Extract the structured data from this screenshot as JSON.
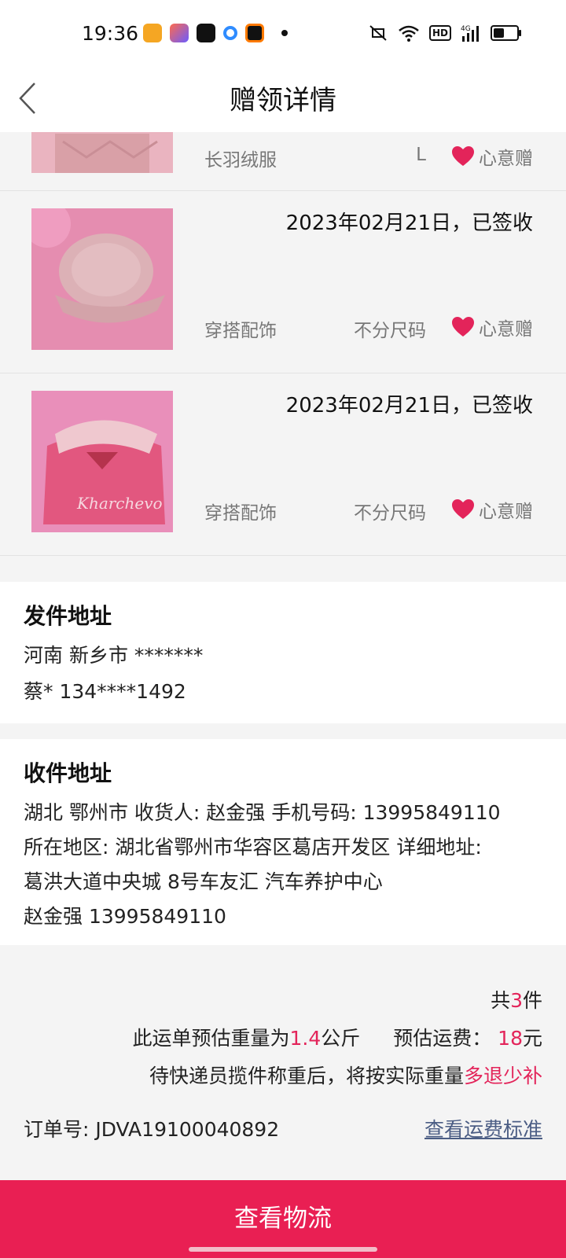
{
  "status_bar": {
    "time": "19:36",
    "network": "4G",
    "hd": "HD"
  },
  "header": {
    "title": "赠领详情"
  },
  "items": [
    {
      "date": "",
      "category": "长羽绒服",
      "size": "L",
      "tag": "心意赠",
      "image": "pink-down-jacket"
    },
    {
      "date": "2023年02月21日，已签收",
      "category": "穿搭配饰",
      "size": "不分尺码",
      "tag": "心意赠",
      "image": "pink-cap"
    },
    {
      "date": "2023年02月21日，已签收",
      "category": "穿搭配饰",
      "size": "不分尺码",
      "tag": "心意赠",
      "image": "pink-visor"
    }
  ],
  "sender": {
    "title": "发件地址",
    "lines": [
      "河南 新乡市 *******",
      "蔡* 134****1492"
    ]
  },
  "receiver": {
    "title": "收件地址",
    "lines": [
      "湖北 鄂州市 收货人: 赵金强 手机号码: 13995849110",
      "所在地区: 湖北省鄂州市华容区葛店开发区 详细地址:",
      "葛洪大道中央城 8号车友汇 汽车养护中心",
      "赵金强 13995849110"
    ]
  },
  "summary": {
    "count_prefix": "共",
    "count": "3",
    "count_suffix": "件",
    "weight_prefix": "此运单预估重量为",
    "weight": "1.4",
    "weight_unit": "公斤",
    "fee_prefix": "预估运费：",
    "fee": "18",
    "fee_unit": "元",
    "note_prefix": "待快递员揽件称重后，将按实际重量",
    "note_highlight": "多退少补",
    "order_label": "订单号:  JDVA19100040892",
    "fee_link": "查看运费标准"
  },
  "logistics_button": "查看物流",
  "colors": {
    "accent": "#e91f53",
    "highlight": "#e3245a",
    "link": "#4b5d84"
  }
}
